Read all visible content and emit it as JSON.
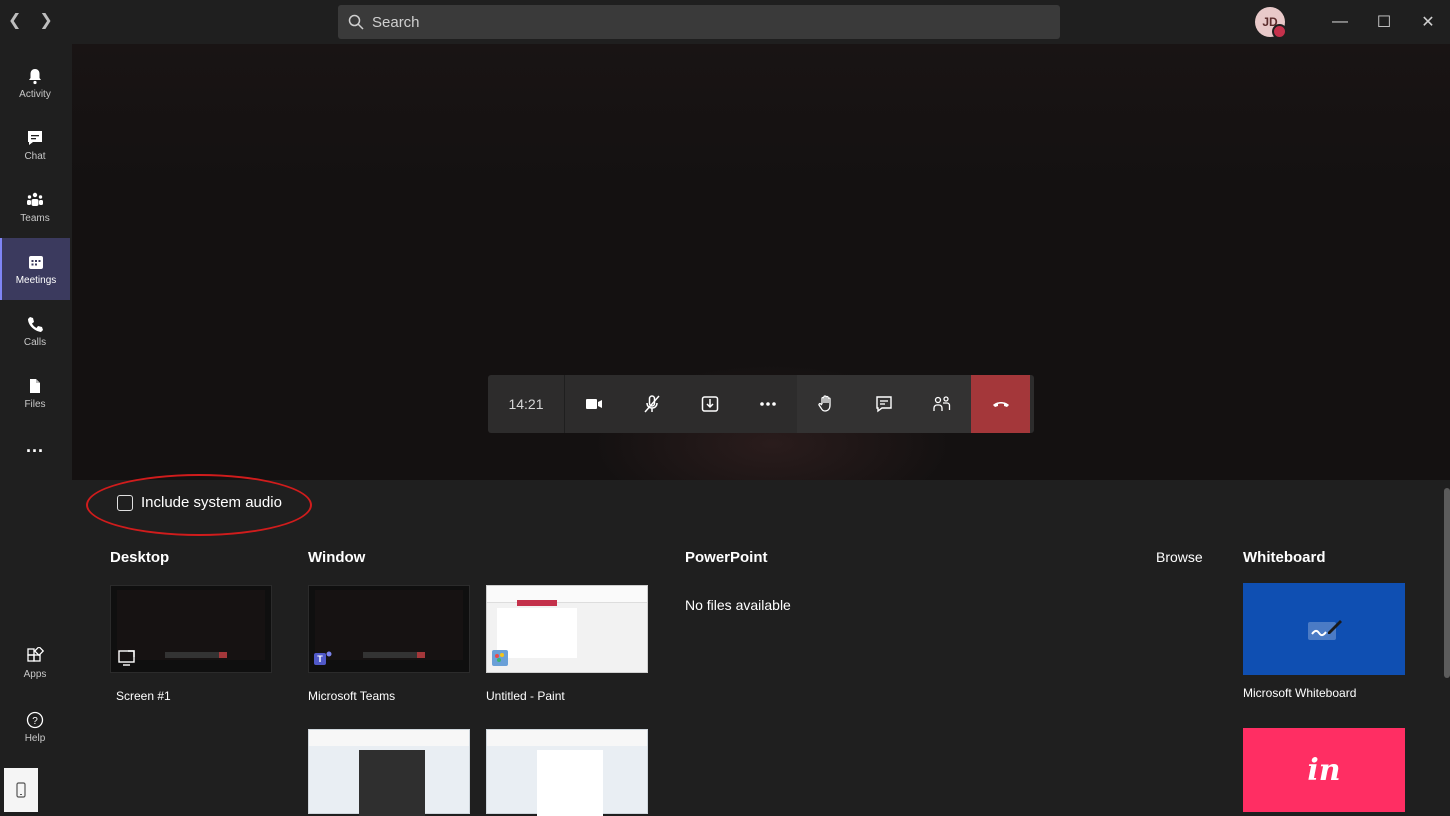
{
  "search": {
    "label": "Search"
  },
  "user": {
    "initials": "JD"
  },
  "rail": {
    "items": [
      {
        "label": "Activity",
        "icon": "bell-icon"
      },
      {
        "label": "Chat",
        "icon": "chat-icon"
      },
      {
        "label": "Teams",
        "icon": "teams-icon"
      },
      {
        "label": "Meetings",
        "icon": "calendar-icon",
        "active": true
      },
      {
        "label": "Calls",
        "icon": "phone-icon"
      },
      {
        "label": "Files",
        "icon": "file-icon"
      },
      {
        "label": "...",
        "icon": "more-icon"
      }
    ],
    "bottom": [
      {
        "label": "Apps",
        "icon": "apps-icon"
      },
      {
        "label": "Help",
        "icon": "help-icon"
      }
    ]
  },
  "call": {
    "timer": "14:21"
  },
  "share": {
    "include_audio": "Include system audio",
    "sections": {
      "desktop": "Desktop",
      "window": "Window",
      "powerpoint": "PowerPoint",
      "browse": "Browse",
      "whiteboard": "Whiteboard"
    },
    "desktop_items": [
      "Screen #1"
    ],
    "window_items": [
      "Microsoft Teams",
      "Untitled - Paint"
    ],
    "powerpoint_empty": "No files available",
    "whiteboard_items": [
      "Microsoft Whiteboard"
    ]
  },
  "colors": {
    "accent": "#7f85f5",
    "hangup": "#a4373a",
    "whiteboard": "#0f4fb2",
    "invision": "#ff2e63",
    "annotation": "#d01c1c"
  }
}
